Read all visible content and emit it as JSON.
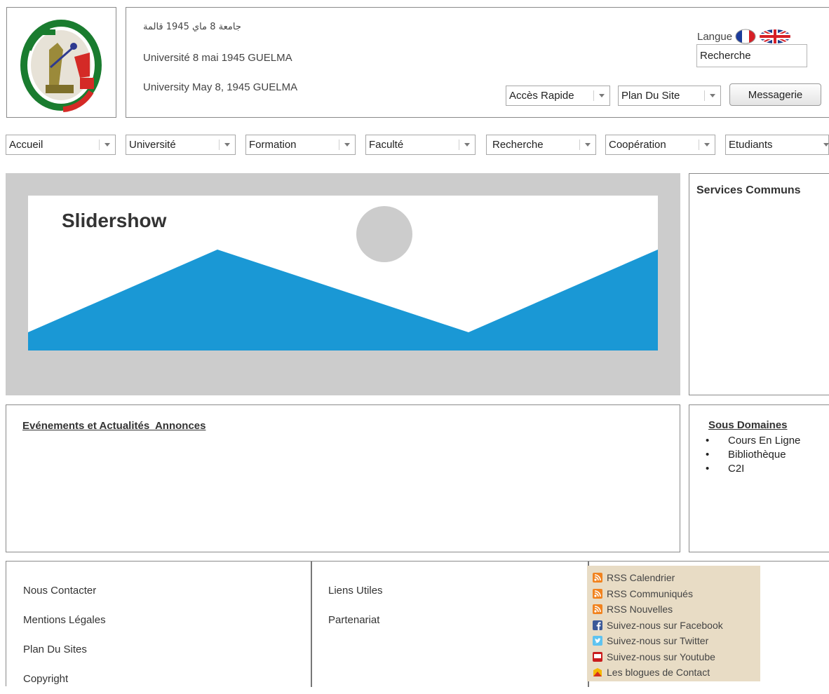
{
  "header": {
    "title_ar": "جامعة 8 ماي 1945 قالمة",
    "title_fr": "Université 8 mai 1945 GUELMA",
    "title_en": "University May 8, 1945 GUELMA",
    "language_label": "Langue",
    "search_value": "Recherche",
    "quick_access_label": "Accès Rapide",
    "site_map_label": "Plan Du Site",
    "messaging_label": "Messagerie"
  },
  "nav": {
    "items": [
      {
        "label": "Accueil"
      },
      {
        "label": "Université"
      },
      {
        "label": "Formation"
      },
      {
        "label": "Faculté"
      },
      {
        "label": "Recherche"
      },
      {
        "label": "Coopération"
      },
      {
        "label": "Etudiants"
      }
    ]
  },
  "slideshow": {
    "label": "Slidershow"
  },
  "services": {
    "title": "Services Communs"
  },
  "events": {
    "title": "Evénements et Actualités  Annonces"
  },
  "subdomains": {
    "title": "Sous Domaines",
    "items": [
      {
        "label": "Cours En Ligne"
      },
      {
        "label": "Bibliothèque"
      },
      {
        "label": "C2I"
      }
    ]
  },
  "footer": {
    "col1": [
      {
        "label": "Nous Contacter"
      },
      {
        "label": "Mentions Légales"
      },
      {
        "label": "Plan Du Sites"
      },
      {
        "label": "Copyright"
      }
    ],
    "col2": [
      {
        "label": "Liens Utiles"
      },
      {
        "label": "Partenariat"
      }
    ],
    "social": [
      {
        "label": "RSS Calendrier",
        "icon": "rss-icon"
      },
      {
        "label": "RSS Communiqués",
        "icon": "rss-icon"
      },
      {
        "label": "RSS Nouvelles",
        "icon": "rss-icon"
      },
      {
        "label": "Suivez-nous sur Facebook",
        "icon": "facebook-icon"
      },
      {
        "label": "Suivez-nous sur Twitter",
        "icon": "twitter-icon"
      },
      {
        "label": "Suivez-nous sur Youtube",
        "icon": "youtube-icon"
      },
      {
        "label": "Les blogues de Contact",
        "icon": "blog-icon"
      }
    ]
  },
  "colors": {
    "slide_mountain": "#1a98d5",
    "slide_background": "#cccccc",
    "social_panel": "#e8dcc5"
  }
}
